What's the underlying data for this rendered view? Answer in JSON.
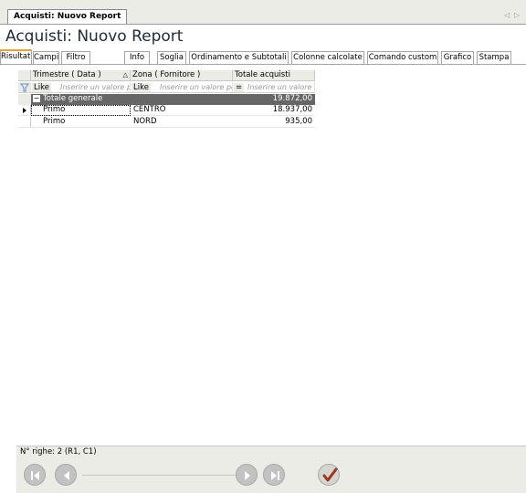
{
  "window": {
    "doc_tab_label": "Acquisti: Nuovo Report",
    "page_title": "Acquisti: Nuovo Report"
  },
  "tabs": [
    {
      "label": "Risultato",
      "active": true
    },
    {
      "label": "Campi"
    },
    {
      "label": "Filtro"
    },
    {
      "label": "Info"
    },
    {
      "label": "Soglia"
    },
    {
      "label": "Ordinamento e Subtotali"
    },
    {
      "label": "Colonne calcolate"
    },
    {
      "label": "Comando custom"
    },
    {
      "label": "Grafico"
    },
    {
      "label": "Stampa"
    }
  ],
  "grid": {
    "columns": [
      "Trimestre ( Data )",
      "Zona ( Fornitore )",
      "Totale acquisti"
    ],
    "sort_indicator": "△",
    "filter": {
      "col1_op": "Like",
      "col1_hint": "Inserire un valore p",
      "col2_op": "Like",
      "col2_hint": "Inserire un valore pe",
      "col3_op": "=",
      "col3_hint": "Inserire un valore"
    },
    "total_row": {
      "expander": "−",
      "label": "Totale generale",
      "value": "19.872,00"
    },
    "rows": [
      {
        "trimestre": "Primo",
        "zona": "CENTRO",
        "totale": "18.937,00"
      },
      {
        "trimestre": "Primo",
        "zona": "NORD",
        "totale": "935,00"
      }
    ]
  },
  "status": {
    "text": "N° righe: 2 (R1, C1)"
  },
  "colors": {
    "accent_tab": "#f0a030",
    "total_row_bg": "#666666",
    "confirm_check": "#a0341c"
  },
  "icons": {
    "nav": [
      "first-record-icon",
      "prev-record-icon",
      "next-record-icon",
      "last-record-icon"
    ],
    "confirm": "checkmark-icon",
    "filter": "filter-icon",
    "row_pointer": "row-pointer-icon"
  }
}
